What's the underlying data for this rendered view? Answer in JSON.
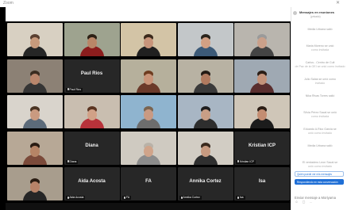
{
  "window": {
    "title": "Zoom",
    "close_icon": "close-icon"
  },
  "gallery": {
    "tiles": [
      {
        "name": "",
        "camera_on": true,
        "scene": "#d8d0c2",
        "skin": "#c89a7c",
        "clothes": "#262626",
        "hair": "#5a4031"
      },
      {
        "name": "",
        "camera_on": true,
        "scene": "#9ea38f",
        "skin": "#b98668",
        "clothes": "#8b1d1d",
        "hair": "#2c2015"
      },
      {
        "name": "",
        "camera_on": true,
        "scene": "#d3c4a6",
        "skin": "#c8957b",
        "clothes": "#202020",
        "hair": "#3b2a1c"
      },
      {
        "name": "",
        "camera_on": true,
        "scene": "#c3c7c9",
        "skin": "#d2a084",
        "clothes": "#3c5a78",
        "hair": "#2a241c"
      },
      {
        "name": "",
        "camera_on": true,
        "scene": "#b9b5ae",
        "skin": "#caa08a",
        "clothes": "#444444",
        "hair": "#9a9a9a"
      },
      {
        "name": "",
        "camera_on": true,
        "scene": "#8c8175",
        "skin": "#b9866c",
        "clothes": "#353535",
        "hair": "#3a2c20"
      },
      {
        "name": "Paul Rios",
        "camera_on": false
      },
      {
        "name": "",
        "camera_on": true,
        "scene": "#b6b09c",
        "skin": "#c99479",
        "clothes": "#6b3a2a",
        "hair": "#6e3c20"
      },
      {
        "name": "",
        "camera_on": true,
        "scene": "#b8b2a3",
        "skin": "#b07a5f",
        "clothes": "#3a3a3a",
        "hair": "#231a14"
      },
      {
        "name": "",
        "camera_on": true,
        "scene": "#9fa9b3",
        "skin": "#c4937a",
        "clothes": "#5a2e2e",
        "hair": "#2b1e16"
      },
      {
        "name": "",
        "camera_on": true,
        "scene": "#d9d4cc",
        "skin": "#c99a80",
        "clothes": "#5c6b7a",
        "hair": "#4a3322"
      },
      {
        "name": "",
        "camera_on": true,
        "scene": "#c9beb0",
        "skin": "#d1a187",
        "clothes": "#b8323a",
        "hair": "#5b3420"
      },
      {
        "name": "",
        "camera_on": true,
        "scene": "#8fb4cf",
        "skin": "#c99a83",
        "clothes": "#6d6d6d",
        "hair": "#7a6450"
      },
      {
        "name": "",
        "camera_on": true,
        "scene": "#a8b6c4",
        "skin": "#c89e86",
        "clothes": "#2e2e2e",
        "hair": "#1e1e1e"
      },
      {
        "name": "",
        "camera_on": true,
        "scene": "#cfc6b8",
        "skin": "#c38d72",
        "clothes": "#1c1c1c",
        "hair": "#2a1c14"
      },
      {
        "name": "",
        "camera_on": true,
        "scene": "#b7a896",
        "skin": "#b68466",
        "clothes": "#7b4a3a",
        "hair": "#2a1c12"
      },
      {
        "name": "Diana",
        "camera_on": false
      },
      {
        "name": "",
        "camera_on": true,
        "scene": "#cfcac1",
        "skin": "#d0a48a",
        "clothes": "#8c8c8c",
        "hair": "#b9b2a8"
      },
      {
        "name": "",
        "camera_on": true,
        "scene": "#d2cdc4",
        "skin": "#c79a80",
        "clothes": "#2f2f2f",
        "hair": "#3a2a1e"
      },
      {
        "name": "Kristian ICP",
        "camera_on": false
      },
      {
        "name": "",
        "camera_on": true,
        "scene": "#a89d8d",
        "skin": "#b88368",
        "clothes": "#262626",
        "hair": "#2a1c12"
      },
      {
        "name": "Aida Acosta",
        "camera_on": false
      },
      {
        "name": "FA",
        "camera_on": false
      },
      {
        "name": "Annika Cortez",
        "camera_on": false
      },
      {
        "name": "Isa",
        "camera_on": false
      }
    ]
  },
  "chat": {
    "header_label": "Mensajes en reuniones",
    "header_sub": "(privado)",
    "messages": [
      {
        "text": "Media Urbana salió",
        "sub": ""
      },
      {
        "text": "Maria Moreno se unió",
        "sub": "como invitada"
      },
      {
        "text": "Carlos - Centro de Cult",
        "sub": "de Paz de la OEI se unió como invitado"
      },
      {
        "text": "Julio Salas se unió como",
        "sub": "invitado"
      },
      {
        "text": "Nika Rivas Torres salió",
        "sub": ""
      },
      {
        "text": "Sílvia Pérez Sacal se unió",
        "sub": "como invitada"
      },
      {
        "text": "Eduardo A.Rico Garcia se",
        "sub": "unió como invitado"
      },
      {
        "text": "Media Urbana salió",
        "sub": ""
      },
      {
        "text": "El verdadero Leon Sacal se",
        "sub": "unió como invitado"
      }
    ],
    "reply_options": [
      {
        "text": "Quién puede ver mis mensajes",
        "selected": false
      },
      {
        "text": "Respondiendo en esta conversación",
        "selected": true
      }
    ],
    "input_placeholder": "Enviar mensaje a Moriyama",
    "toolbar_icons": [
      "emoji-icon",
      "file-icon",
      "more-icon"
    ]
  },
  "colors": {
    "background": "#000000",
    "tile": "#2a2a2a",
    "chat_accent": "#1f6fd6",
    "chat_text": "#9a9a9a"
  }
}
